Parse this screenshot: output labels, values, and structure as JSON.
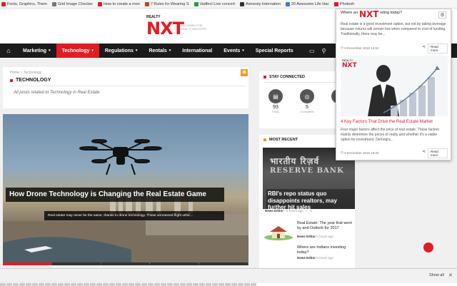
{
  "bookmarks": [
    {
      "label": "Fonts, Graphics, Them",
      "color": "#e31b23"
    },
    {
      "label": "Grid Image Checker",
      "color": "#777"
    },
    {
      "label": "How to create a mon",
      "color": "#e31b23"
    },
    {
      "label": "7 Rules for Wearing S",
      "color": "#d04020"
    },
    {
      "label": "Vadfect Live concert",
      "color": "#2a9d3a"
    },
    {
      "label": "Amnesty Internation",
      "color": "#333"
    },
    {
      "label": "20 Awesome Life Hac",
      "color": "#3a7bd5"
    },
    {
      "label": "Photosh",
      "color": "#e31b23"
    }
  ],
  "logo": {
    "small": "REALTY",
    "big": "NXT",
    "tagline": "DECODING THE REALTY INDUSTRY"
  },
  "nav": {
    "items": [
      {
        "label": "Marketing",
        "dropdown": true,
        "active": false
      },
      {
        "label": "Technology",
        "dropdown": true,
        "active": true
      },
      {
        "label": "Regulations",
        "dropdown": true,
        "active": false
      },
      {
        "label": "Rentals",
        "dropdown": true,
        "active": false
      },
      {
        "label": "International",
        "dropdown": false,
        "active": false
      },
      {
        "label": "Events",
        "dropdown": true,
        "active": false
      },
      {
        "label": "Special Reports",
        "dropdown": false,
        "active": false
      }
    ]
  },
  "category": {
    "breadcrumb": "Home > Technology",
    "title": "TECHNOLOGY",
    "description": "All posts related to Technology in Real Estate"
  },
  "hero": {
    "title": "How Drone Technology is Changing the Real Estate Game",
    "excerpt": "Real estate may never be the same, thanks to drone technology. These unmanned flight vehic..."
  },
  "stay_connected": {
    "title": "STAY CONNECTED",
    "stats": [
      {
        "count": "93",
        "label": "Posts"
      },
      {
        "count": "5",
        "label": "Comments"
      },
      {
        "count": "",
        "label": ""
      }
    ]
  },
  "most_recent": {
    "title": "MOST RECENT",
    "featured": {
      "img_text_1": "भारतीय रिज़र्व",
      "img_text_2": "RESERVE BANK",
      "title": "RBI's repo status quo disappoints realtors, may further hit sales",
      "author": "News Editor",
      "time": "5 hours ago",
      "comments": "0"
    },
    "items": [
      {
        "title": "Real Estate: The year that went by and Outlook for 2017",
        "author": "News Editor",
        "time": "5 hours ago"
      },
      {
        "title": "Where are Indians investing today?",
        "author": "News Editor",
        "time": "6 hours ago"
      }
    ]
  },
  "popup": {
    "top_title": "Where are Indians investing today?",
    "logo": "NXT",
    "description": "Real estate is a good investment option, but not by taking leverage because returns will remain low when compared to cost of funding. Traditionally, there may be...",
    "date1": "9 December 2016 14:52",
    "read_more": "Read more",
    "article2_title": "4 Key Factors That Drive the Real Estate Market",
    "article2_desc": "Four major factors affect the price of real estate. These factors mainly determine the prices of realty and whether it's a viable option for investment. Demogra...",
    "date2": "9 December 2016 16:20"
  },
  "downloads": {
    "show_all": "Show all"
  }
}
